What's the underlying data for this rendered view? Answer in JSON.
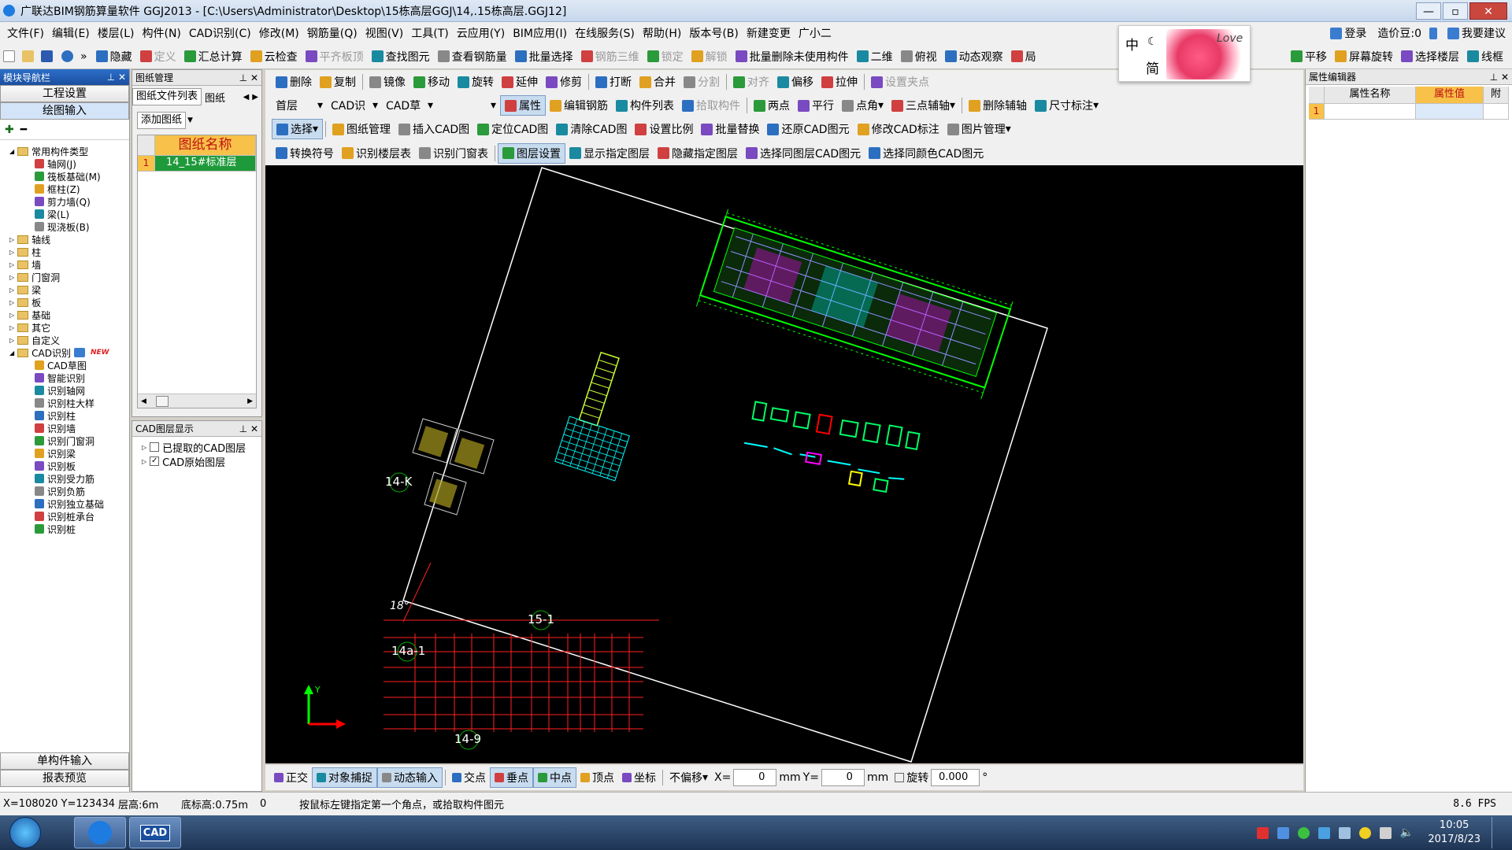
{
  "titlebar": {
    "title": "广联达BIM钢筋算量软件 GGJ2013 - [C:\\Users\\Administrator\\Desktop\\15栋高层GGJ\\14,.15栋高层.GGJ12]",
    "min": "—",
    "max": "▫",
    "close": "✕"
  },
  "menu": [
    "文件(F)",
    "编辑(E)",
    "楼层(L)",
    "构件(N)",
    "CAD识别(C)",
    "修改(M)",
    "钢筋量(Q)",
    "视图(V)",
    "工具(T)",
    "云应用(Y)",
    "BIM应用(I)",
    "在线服务(S)",
    "帮助(H)",
    "版本号(B)",
    "新建变更",
    "广小二"
  ],
  "menu_right": {
    "login": "登录",
    "coin": "造价豆:0",
    "suggest": "我要建议"
  },
  "ime": {
    "zh": "中",
    "simp": "简",
    "love": "Love"
  },
  "mainbar": [
    "隐藏",
    "定义",
    "汇总计算",
    "云检查",
    "平齐板顶",
    "查找图元",
    "查看钢筋量",
    "批量选择",
    "钢筋三维",
    "锁定",
    "解锁",
    "批量删除未使用构件",
    "二维",
    "俯视",
    "动态观察",
    "局"
  ],
  "mainbar_right": [
    "平移",
    "屏幕旋转",
    "选择楼层",
    "线框"
  ],
  "toolbar1": [
    "删除",
    "复制",
    "镜像",
    "移动",
    "旋转",
    "延伸",
    "修剪",
    "打断",
    "合并",
    "分割",
    "对齐",
    "偏移",
    "拉伸",
    "设置夹点"
  ],
  "toolbar2": {
    "floor": "首层",
    "cad_id": "CAD识",
    "cad_draft": "CAD草",
    "blank": "",
    "items": [
      "属性",
      "编辑钢筋",
      "构件列表",
      "拾取构件",
      "两点",
      "平行",
      "点角",
      "三点辅轴",
      "删除辅轴",
      "尺寸标注"
    ]
  },
  "toolbar3": [
    "选择",
    "图纸管理",
    "插入CAD图",
    "定位CAD图",
    "清除CAD图",
    "设置比例",
    "批量替换",
    "还原CAD图元",
    "修改CAD标注",
    "图片管理"
  ],
  "toolbar4": [
    "转换符号",
    "识别楼层表",
    "识别门窗表",
    "图层设置",
    "显示指定图层",
    "隐藏指定图层",
    "选择同图层CAD图元",
    "选择同颜色CAD图元"
  ],
  "nav": {
    "title": "模块导航栏",
    "btn1": "工程设置",
    "btn2": "绘图输入",
    "bottom1": "单构件输入",
    "bottom2": "报表预览",
    "tree": [
      {
        "label": "常用构件类型",
        "level": 0,
        "type": "folder-open"
      },
      {
        "label": "轴网(J)",
        "level": 1
      },
      {
        "label": "筏板基础(M)",
        "level": 1
      },
      {
        "label": "框柱(Z)",
        "level": 1
      },
      {
        "label": "剪力墙(Q)",
        "level": 1
      },
      {
        "label": "梁(L)",
        "level": 1
      },
      {
        "label": "现浇板(B)",
        "level": 1
      },
      {
        "label": "轴线",
        "level": 0,
        "type": "folder"
      },
      {
        "label": "柱",
        "level": 0,
        "type": "folder"
      },
      {
        "label": "墙",
        "level": 0,
        "type": "folder"
      },
      {
        "label": "门窗洞",
        "level": 0,
        "type": "folder"
      },
      {
        "label": "梁",
        "level": 0,
        "type": "folder"
      },
      {
        "label": "板",
        "level": 0,
        "type": "folder"
      },
      {
        "label": "基础",
        "level": 0,
        "type": "folder"
      },
      {
        "label": "其它",
        "level": 0,
        "type": "folder"
      },
      {
        "label": "自定义",
        "level": 0,
        "type": "folder"
      },
      {
        "label": "CAD识别",
        "level": 0,
        "type": "folder-open",
        "badge": "NEW"
      },
      {
        "label": "CAD草图",
        "level": 1
      },
      {
        "label": "智能识别",
        "level": 1
      },
      {
        "label": "识别轴网",
        "level": 1
      },
      {
        "label": "识别柱大样",
        "level": 1
      },
      {
        "label": "识别柱",
        "level": 1
      },
      {
        "label": "识别墙",
        "level": 1
      },
      {
        "label": "识别门窗洞",
        "level": 1
      },
      {
        "label": "识别梁",
        "level": 1
      },
      {
        "label": "识别板",
        "level": 1
      },
      {
        "label": "识别受力筋",
        "level": 1
      },
      {
        "label": "识别负筋",
        "level": 1
      },
      {
        "label": "识别独立基础",
        "level": 1
      },
      {
        "label": "识别桩承台",
        "level": 1
      },
      {
        "label": "识别桩",
        "level": 1
      }
    ]
  },
  "drawings": {
    "title": "图纸管理",
    "tab1": "图纸文件列表",
    "tab2": "图纸",
    "add": "添加图纸",
    "col": "图纸名称",
    "row_num": "1",
    "row_name": "14_15#标准层"
  },
  "layers": {
    "title": "CAD图层显示",
    "item1": "已提取的CAD图层",
    "item2": "CAD原始图层"
  },
  "props": {
    "title": "属性编辑器",
    "col1": "属性名称",
    "col2": "属性值",
    "col3": "附",
    "row": "1"
  },
  "canvas": {
    "labels": {
      "l14k": "14-K",
      "l15_1": "15-1",
      "l14a_1": "14a-1",
      "l14_9": "14-9",
      "angle": "18°",
      "y": "Y"
    }
  },
  "snapbar": {
    "items": [
      "正交",
      "对象捕捉",
      "动态输入",
      "交点",
      "垂点",
      "中点",
      "顶点",
      "坐标",
      "不偏移"
    ],
    "x_label": "X=",
    "x_val": "0",
    "mm1": "mm",
    "y_label": "Y=",
    "y_val": "0",
    "mm2": "mm",
    "rotate": "旋转",
    "rot_val": "0.000",
    "deg": "°"
  },
  "status": {
    "coords": "X=108020 Y=123434",
    "floor_h": "层高:6m",
    "bottom_h": "底标高:0.75m",
    "zero": "0",
    "hint": "按鼠标左键指定第一个角点，或拾取构件图元",
    "fps": "8.6 FPS"
  },
  "taskbar": {
    "time": "10:05",
    "date": "2017/8/23",
    "cad": "CAD"
  },
  "colors": {
    "accent": "#1a4fa0",
    "green": "#00ff00",
    "cyan": "#00ffff",
    "magenta": "#ff00ff",
    "red": "#ff0000",
    "yellow": "#ffff00"
  }
}
